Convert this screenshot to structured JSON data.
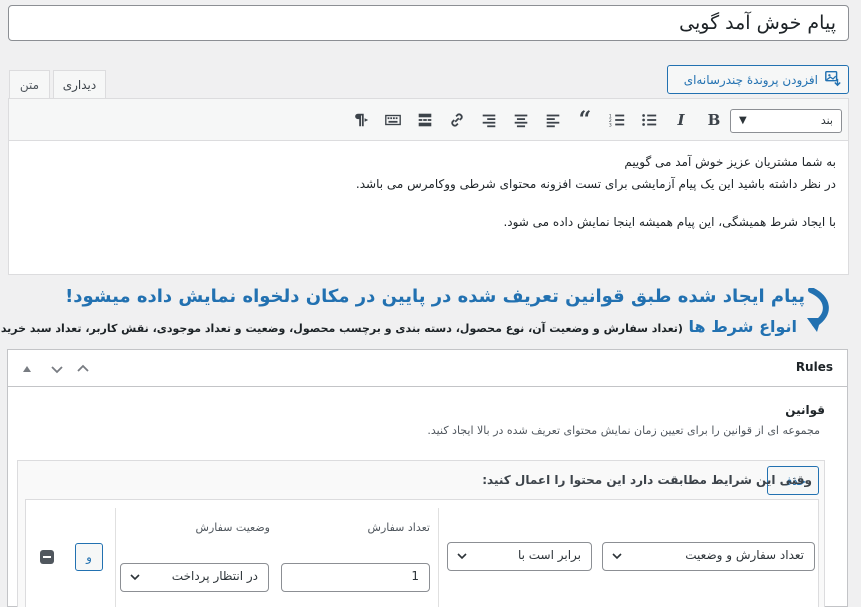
{
  "post_title": "پیام خوش آمد گویی",
  "editor": {
    "add_media_label": "افزودن پروندهٔ چندرسانه‌ای",
    "tabs": {
      "visual": "دیداری",
      "text": "متن"
    },
    "format_select": "بند",
    "toolbar_icons": [
      "bold-icon",
      "italic-icon",
      "bullet-list-icon",
      "numbered-list-icon",
      "blockquote-icon",
      "align-left-icon",
      "align-center-icon",
      "align-right-icon",
      "link-icon",
      "read-more-icon",
      "toolbar-toggle-icon",
      "rtl-paragraph-icon"
    ],
    "content_lines": [
      "به شما مشتریان عزیز خوش آمد می گوییم",
      "در نظر داشته باشید این یک پیام آزمایشی برای تست افزونه محتوای شرطی ووکامرس می باشد.",
      "",
      "با ایجاد شرط همیشگی، این پیام همیشه اینجا نمایش داده می شود."
    ]
  },
  "annotation": {
    "line1": "پیام ایجاد شده طبق قوانین تعریف شده در پایین در مکان دلخواه نمایش داده میشود!",
    "line2_main": "انواع شرط ها",
    "line2_detail": "(تعداد سفارش و وضعیت آن، نوع محصول، دسته بندی و برچسب محصول، وضعیت و تعداد موجودی، نقش کاربر، تعداد سبد خرید و ...)",
    "color": "#2271b1"
  },
  "rules_panel": {
    "title": "Rules",
    "section_label": "قوانین",
    "section_desc": "مجموعه ای از قوانین را برای تعیین زمان نمایش محتوای تعریف شده در بالا ایجاد کنید.",
    "group": {
      "title": "وقتی این شرایط مطابقت دارد این محتوا را اعمال کنید:",
      "delete_label": "حذف",
      "rule": {
        "type_value": "تعداد سفارش و وضعیت",
        "operator_value": "برابر است با",
        "count_label": "تعداد سفارش",
        "count_value": "1",
        "status_label": "وضعیت سفارش",
        "status_value": "در انتظار پرداخت",
        "and_label": "و"
      }
    }
  }
}
